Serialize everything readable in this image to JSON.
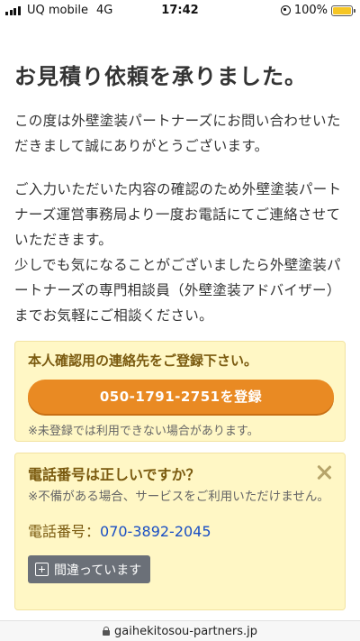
{
  "status_bar": {
    "carrier": "UQ mobile",
    "network": "4G",
    "time": "17:42",
    "battery_percent": "100%",
    "battery_level": 1.0
  },
  "page": {
    "title": "お見積り依頼を承りました。",
    "paragraph1": "この度は外壁塗装パートナーズにお問い合わせいただきまして誠にありがとうございます。",
    "paragraph2": "ご入力いただいた内容の確認のため外壁塗装パートナーズ運営事務局より一度お電話にてご連絡させていただきます。",
    "paragraph3": "少しでも気になることがございましたら外壁塗装パートナーズの専門相談員（外壁塗装アドバイザー）までお気軽にご相談ください。"
  },
  "register_box": {
    "heading": "本人確認用の連絡先をご登録下さい。",
    "button_label": "050-1791-2751を登録",
    "note": "※未登録では利用できない場合があります。"
  },
  "phone_box": {
    "heading": "電話番号は正しいですか？",
    "note": "※不備がある場合、サービスをご利用いただけません。",
    "phone_label": "電話番号：",
    "phone_number": "070-3892-2045",
    "wrong_button_label": "間違っています"
  },
  "url_bar": {
    "domain": "gaihekitosou-partners.jp"
  },
  "colors": {
    "accent_orange": "#e98a23",
    "notice_background": "#fff7c5",
    "phone_link": "#1a4fc4",
    "battery": "#f6c624"
  }
}
